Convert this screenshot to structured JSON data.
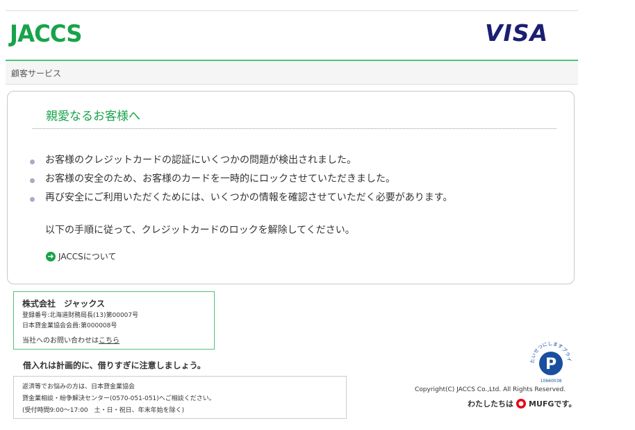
{
  "header": {
    "brand_logo": "JACCS",
    "card_logo": "VISA",
    "brand_color": "#17a34a",
    "card_color": "#1a1f71"
  },
  "nav": {
    "label": "顧客サービス"
  },
  "panel": {
    "title": "親愛なるお客様へ",
    "bullets": [
      "お客様のクレジットカードの認証にいくつかの問題が検出されました。",
      "お客様の安全のため、お客様のカードを一時的にロックさせていただきました。",
      "再び安全にご利用いただくためには、いくつかの情報を確認させていただく必要があります。"
    ],
    "instruction": "以下の手順に従って、クレジットカードのロックを解除してください。",
    "about_link": "JACCSについて",
    "about_icon": "arrow-right-circle-icon"
  },
  "company": {
    "name": "株式会社　ジャックス",
    "registration": "登録番号:北海道財務局長(13)第00007号",
    "membership": "日本貸金業協会会員:第000008号",
    "contact_prefix": "当社へのお問い合わせは",
    "contact_link": "こちら"
  },
  "warning": "借入れは計画的に、借りすぎに注意しましょう。",
  "consult": {
    "line1": "返済等でお悩みの方は、日本貸金業協会",
    "line2": "貸金業相談・紛争解決センター(0570-051-051)へご相談ください。",
    "line3": "(受付時間9:00～17:00　土・日・祝日、年末年始を除く)"
  },
  "privacy": {
    "arc_text": "たいせつにしますプライバシー",
    "number": "10660038",
    "icon": "privacy-mark-icon"
  },
  "footer": {
    "copyright": "Copyright(C) JACCS Co.,Ltd. All Rights Reserved.",
    "mufg_prefix": "わたしたちは",
    "mufg_suffix": "MUFGです。",
    "mufg_color": "#e60012"
  }
}
